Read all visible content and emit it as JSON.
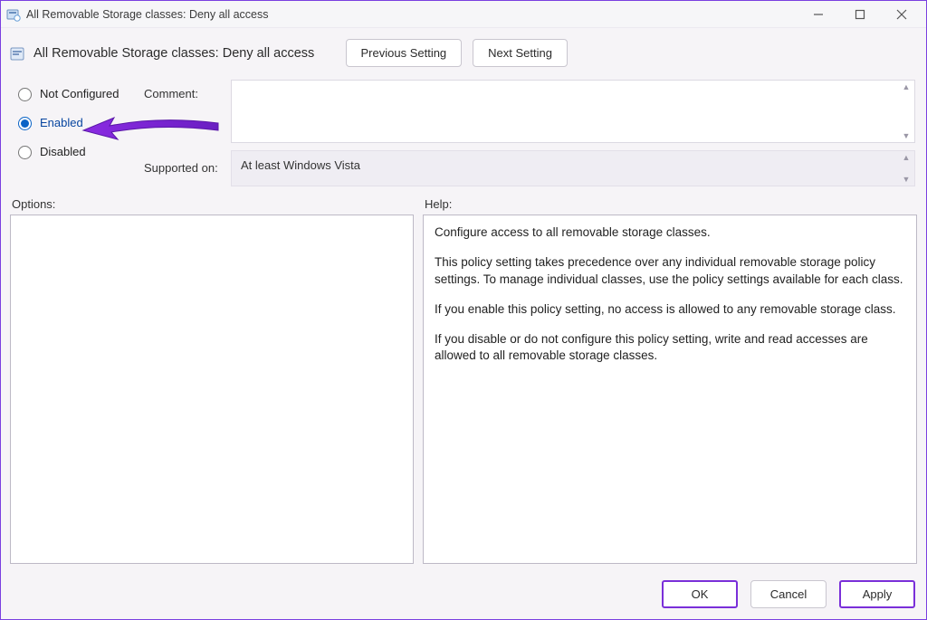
{
  "title": "All Removable Storage classes: Deny all access",
  "heading": "All Removable Storage classes: Deny all access",
  "nav": {
    "previous": "Previous Setting",
    "next": "Next Setting"
  },
  "state": {
    "not_configured": "Not Configured",
    "enabled": "Enabled",
    "disabled": "Disabled",
    "selected": "enabled"
  },
  "labels": {
    "comment": "Comment:",
    "supported_on": "Supported on:",
    "options": "Options:",
    "help": "Help:"
  },
  "comment_value": "",
  "supported_on_value": "At least Windows Vista",
  "help_text": {
    "p1": "Configure access to all removable storage classes.",
    "p2": "This policy setting takes precedence over any individual removable storage policy settings. To manage individual classes, use the policy settings available for each class.",
    "p3": "If you enable this policy setting, no access is allowed to any removable storage class.",
    "p4": "If you disable or do not configure this policy setting, write and read accesses are allowed to all removable storage classes."
  },
  "footer": {
    "ok": "OK",
    "cancel": "Cancel",
    "apply": "Apply"
  },
  "colors": {
    "accent_purple": "#7a2fd9",
    "radio_blue": "#0a63c6"
  }
}
